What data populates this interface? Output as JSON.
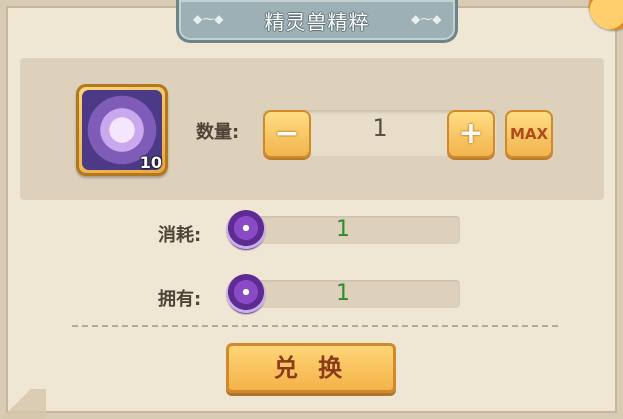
{
  "title": "精灵兽精粹",
  "item": {
    "icon": "crystal-essence-icon",
    "count": "10"
  },
  "quantity": {
    "label": "数量:",
    "value": "1",
    "minus": "−",
    "plus": "+",
    "max": "MAX"
  },
  "consume": {
    "label": "消耗:",
    "icon": "purple-coin-icon",
    "value": "1"
  },
  "own": {
    "label": "拥有:",
    "icon": "purple-coin-icon",
    "value": "1"
  },
  "exchange_button": "兑 换",
  "colors": {
    "title_plate": "#9db0b5",
    "button": "#f3b046",
    "value_green": "#2f8b2f"
  }
}
